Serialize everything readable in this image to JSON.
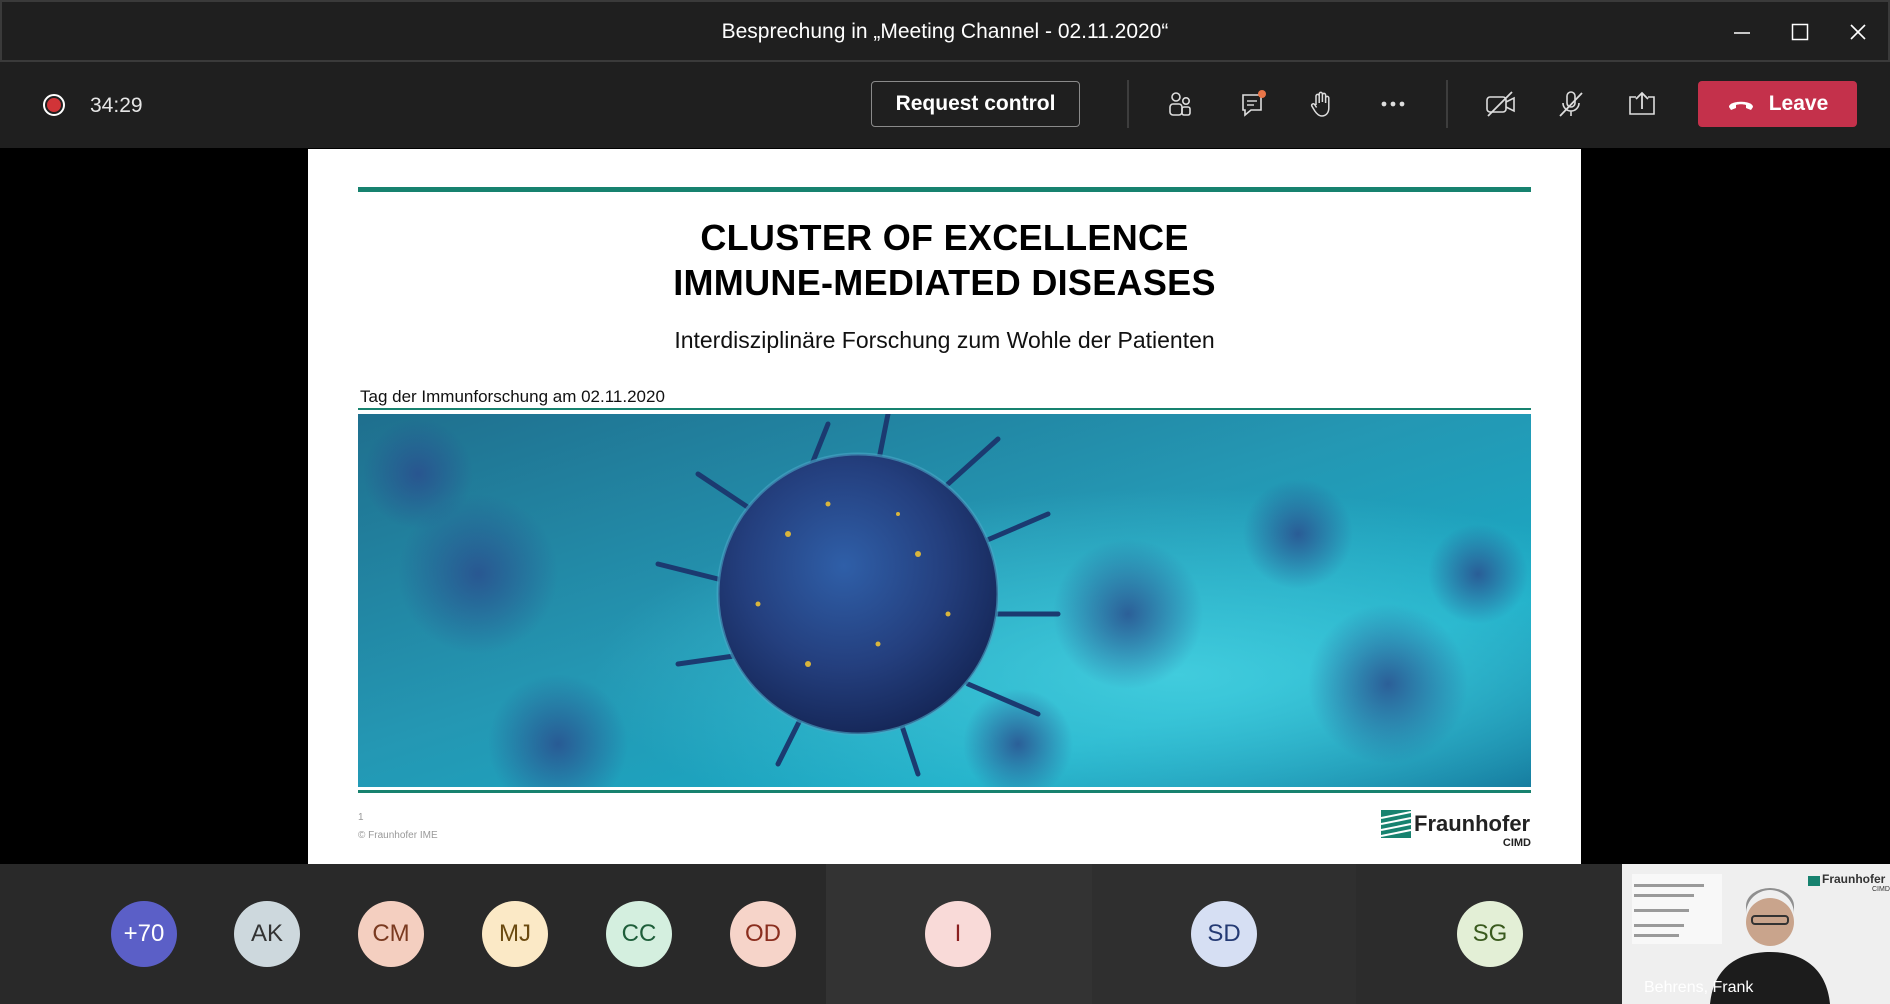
{
  "window": {
    "title": "Besprechung in „Meeting Channel - 02.11.2020“"
  },
  "toolbar": {
    "timer": "34:29",
    "request_control_label": "Request control",
    "leave_label": "Leave",
    "icons": [
      "participants-icon",
      "chat-icon",
      "raise-hand-icon",
      "more-icon",
      "camera-off-icon",
      "mic-off-icon",
      "share-screen-icon"
    ]
  },
  "slide": {
    "title_line1": "CLUSTER OF EXCELLENCE",
    "title_line2": "IMMUNE-MEDIATED DISEASES",
    "subtitle": "Interdisziplinäre Forschung zum Wohle der Patienten",
    "date_line": "Tag der Immunforschung am 02.11.2020",
    "page_number": "1",
    "copyright": "© Fraunhofer IME",
    "logo_name": "Fraunhofer",
    "logo_sub": "CIMD",
    "accent_color": "#17826f"
  },
  "participants": [
    {
      "initials": "+70",
      "bg": "#5b5fc7",
      "fg": "#ffffff"
    },
    {
      "initials": "AK",
      "bg": "#cdd8dd",
      "fg": "#333333"
    },
    {
      "initials": "CM",
      "bg": "#f4cfc0",
      "fg": "#7a3a20"
    },
    {
      "initials": "MJ",
      "bg": "#fbe9c6",
      "fg": "#6b4a10"
    },
    {
      "initials": "CC",
      "bg": "#d4efdf",
      "fg": "#1e5e3a"
    },
    {
      "initials": "OD",
      "bg": "#f6d4c9",
      "fg": "#8a2e1e"
    },
    {
      "initials": "I",
      "bg": "#f9dad8",
      "fg": "#8a1f1f"
    },
    {
      "initials": "SD",
      "bg": "#d6dff3",
      "fg": "#243a73"
    },
    {
      "initials": "SG",
      "bg": "#e3efd6",
      "fg": "#3a5a1e"
    }
  ],
  "video": {
    "name": "Behrens, Frank",
    "logo": "Fraunhofer",
    "logo_sub": "CIMD"
  },
  "colors": {
    "leave": "#c4314b",
    "recording": "#d13438",
    "background": "#1f1f1f"
  }
}
